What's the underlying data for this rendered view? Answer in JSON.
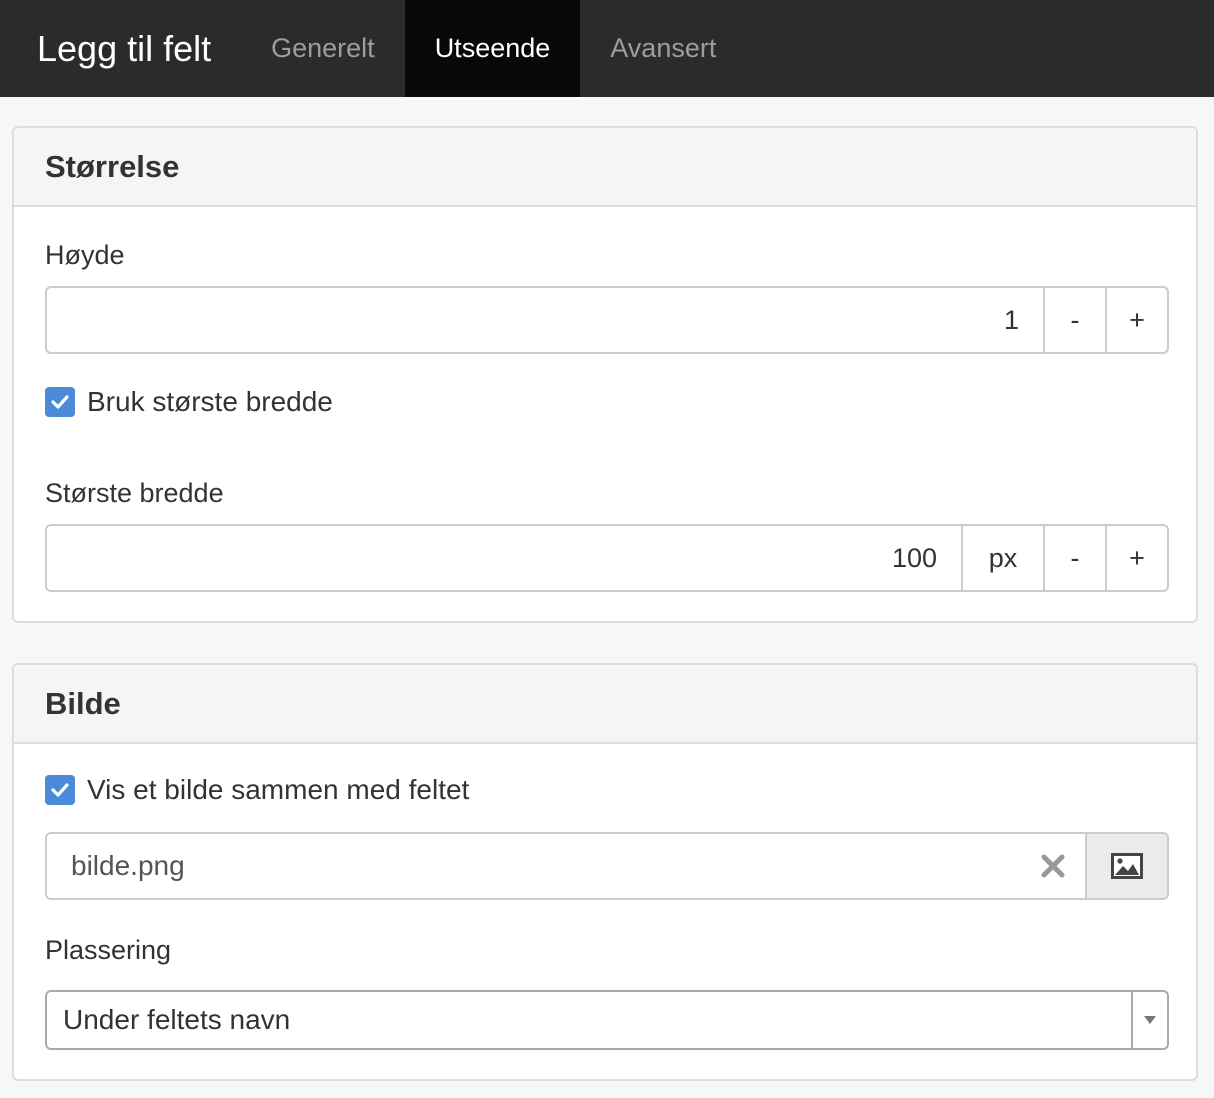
{
  "header": {
    "title": "Legg til felt",
    "tabs": [
      {
        "label": "Generelt",
        "active": false
      },
      {
        "label": "Utseende",
        "active": true
      },
      {
        "label": "Avansert",
        "active": false
      }
    ]
  },
  "size_panel": {
    "title": "Størrelse",
    "height_label": "Høyde",
    "height_value": "1",
    "decrement_label": "-",
    "increment_label": "+",
    "use_max_width_label": "Bruk største bredde",
    "use_max_width_checked": true,
    "max_width_label": "Største bredde",
    "max_width_value": "100",
    "max_width_unit": "px"
  },
  "image_panel": {
    "title": "Bilde",
    "show_image_label": "Vis et bilde sammen med feltet",
    "show_image_checked": true,
    "filename": "bilde.png",
    "placement_label": "Plassering",
    "placement_value": "Under feltets navn"
  },
  "icons": {
    "checkbox": "check-icon",
    "clear": "close-icon",
    "browse": "image-icon",
    "select_arrow": "caret-down-icon"
  },
  "colors": {
    "topbar": "#2b2b2b",
    "active_tab": "#080808",
    "checkbox": "#4a8ad8"
  }
}
